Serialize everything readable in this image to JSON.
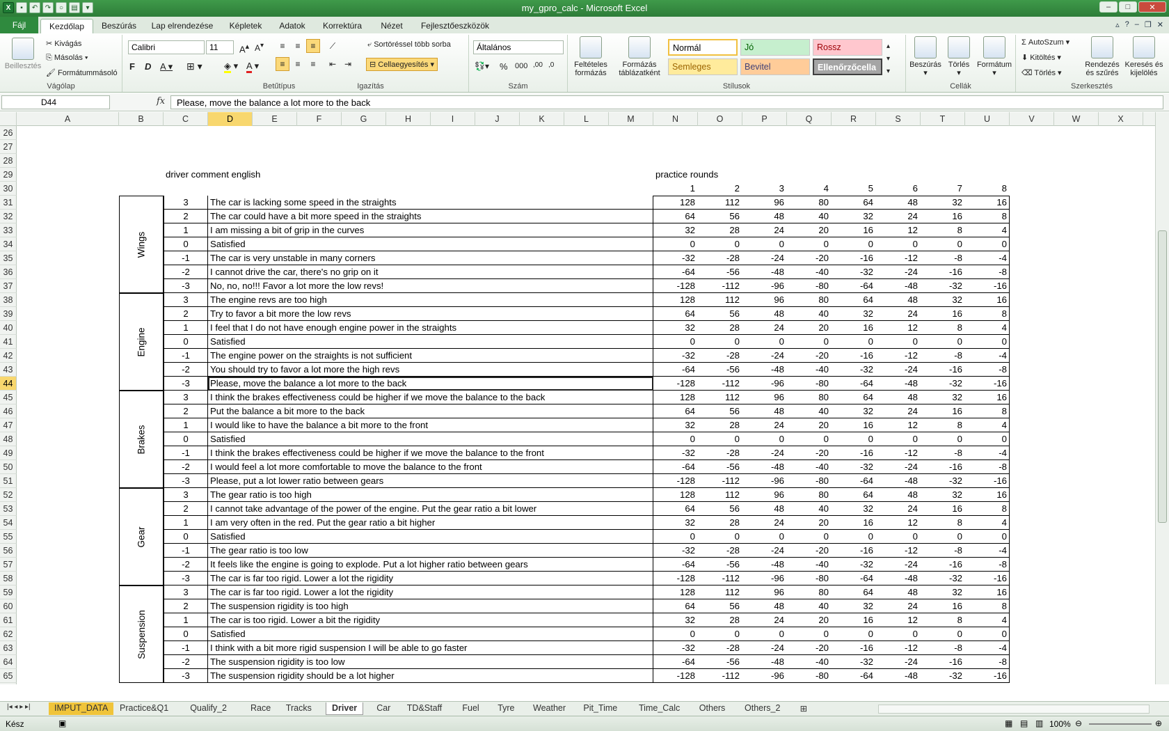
{
  "window": {
    "title": "my_gpro_calc - Microsoft Excel"
  },
  "tabs": [
    "Fájl",
    "Kezdőlap",
    "Beszúrás",
    "Lap elrendezése",
    "Képletek",
    "Adatok",
    "Korrektúra",
    "Nézet",
    "Fejlesztőeszközök"
  ],
  "ribbon": {
    "clipboard": {
      "label": "Vágólap",
      "paste": "Beillesztés",
      "cut": "Kivágás",
      "copy": "Másolás",
      "painter": "Formátummásoló"
    },
    "font": {
      "label": "Betűtípus",
      "name": "Calibri",
      "size": "11"
    },
    "alignment": {
      "label": "Igazítás",
      "wrap": "Sortöréssel több sorba",
      "merge": "Cellaegyesítés"
    },
    "number": {
      "label": "Szám",
      "format": "Általános"
    },
    "styles": {
      "label": "Stílusok",
      "cond": "Feltételes formázás",
      "astable": "Formázás táblázatként",
      "cells": [
        "Normál",
        "Jó",
        "Rossz",
        "Semleges",
        "Bevitel",
        "Ellenőrzőcella"
      ]
    },
    "cells": {
      "label": "Cellák",
      "insert": "Beszúrás",
      "delete": "Törlés",
      "format": "Formátum"
    },
    "editing": {
      "label": "Szerkesztés",
      "autosum": "AutoSzum",
      "fill": "Kitöltés",
      "clear": "Törlés",
      "sort": "Rendezés és szűrés",
      "find": "Keresés és kijelölés"
    }
  },
  "formula_bar": {
    "name_box": "D44",
    "fx": "fx",
    "content": "Please, move the balance a lot more to the back"
  },
  "columns": [
    "A",
    "B",
    "C",
    "D",
    "E",
    "F",
    "G",
    "H",
    "I",
    "J",
    "K",
    "L",
    "M",
    "N",
    "O",
    "P",
    "Q",
    "R",
    "S",
    "T",
    "U",
    "V",
    "W",
    "X"
  ],
  "sheet": {
    "header_left": "driver comment  english",
    "header_right": "practice rounds",
    "rounds": [
      "1",
      "2",
      "3",
      "4",
      "5",
      "6",
      "7",
      "8"
    ],
    "groups": [
      "Wings",
      "Engine",
      "Brakes",
      "Gear",
      "Suspension"
    ],
    "rows": [
      [
        "3",
        "The car is lacking some speed in the straights",
        "128",
        "112",
        "96",
        "80",
        "64",
        "48",
        "32",
        "16"
      ],
      [
        "2",
        "The car could have a bit more speed in the straights",
        "64",
        "56",
        "48",
        "40",
        "32",
        "24",
        "16",
        "8"
      ],
      [
        "1",
        "I am missing a bit of grip in the curves",
        "32",
        "28",
        "24",
        "20",
        "16",
        "12",
        "8",
        "4"
      ],
      [
        "0",
        "Satisfied",
        "0",
        "0",
        "0",
        "0",
        "0",
        "0",
        "0",
        "0"
      ],
      [
        "-1",
        "The car is very unstable in many corners",
        "-32",
        "-28",
        "-24",
        "-20",
        "-16",
        "-12",
        "-8",
        "-4"
      ],
      [
        "-2",
        "I cannot drive the car, there's no grip on it",
        "-64",
        "-56",
        "-48",
        "-40",
        "-32",
        "-24",
        "-16",
        "-8"
      ],
      [
        "-3",
        "No, no, no!!! Favor a lot more the low revs!",
        "-128",
        "-112",
        "-96",
        "-80",
        "-64",
        "-48",
        "-32",
        "-16"
      ],
      [
        "3",
        "The engine revs are too high",
        "128",
        "112",
        "96",
        "80",
        "64",
        "48",
        "32",
        "16"
      ],
      [
        "2",
        "Try to favor a bit more the low revs",
        "64",
        "56",
        "48",
        "40",
        "32",
        "24",
        "16",
        "8"
      ],
      [
        "1",
        "I feel that I do not have enough engine power in the straights",
        "32",
        "28",
        "24",
        "20",
        "16",
        "12",
        "8",
        "4"
      ],
      [
        "0",
        "Satisfied",
        "0",
        "0",
        "0",
        "0",
        "0",
        "0",
        "0",
        "0"
      ],
      [
        "-1",
        "The engine power on the straights is not sufficient",
        "-32",
        "-28",
        "-24",
        "-20",
        "-16",
        "-12",
        "-8",
        "-4"
      ],
      [
        "-2",
        "You should try to favor a lot more the high revs",
        "-64",
        "-56",
        "-48",
        "-40",
        "-32",
        "-24",
        "-16",
        "-8"
      ],
      [
        "-3",
        "Please, move the balance a lot more to the back",
        "-128",
        "-112",
        "-96",
        "-80",
        "-64",
        "-48",
        "-32",
        "-16"
      ],
      [
        "3",
        "I think the brakes effectiveness could be higher if we move the balance to the back",
        "128",
        "112",
        "96",
        "80",
        "64",
        "48",
        "32",
        "16"
      ],
      [
        "2",
        "Put the balance a bit more to the back",
        "64",
        "56",
        "48",
        "40",
        "32",
        "24",
        "16",
        "8"
      ],
      [
        "1",
        "I would like to have the balance a bit more to the front",
        "32",
        "28",
        "24",
        "20",
        "16",
        "12",
        "8",
        "4"
      ],
      [
        "0",
        "Satisfied",
        "0",
        "0",
        "0",
        "0",
        "0",
        "0",
        "0",
        "0"
      ],
      [
        "-1",
        "I think the brakes effectiveness could be higher if we move the balance to the front",
        "-32",
        "-28",
        "-24",
        "-20",
        "-16",
        "-12",
        "-8",
        "-4"
      ],
      [
        "-2",
        "I would feel a lot more comfortable to move the balance to the front",
        "-64",
        "-56",
        "-48",
        "-40",
        "-32",
        "-24",
        "-16",
        "-8"
      ],
      [
        "-3",
        "Please, put a lot lower ratio between gears",
        "-128",
        "-112",
        "-96",
        "-80",
        "-64",
        "-48",
        "-32",
        "-16"
      ],
      [
        "3",
        "The gear ratio is too high",
        "128",
        "112",
        "96",
        "80",
        "64",
        "48",
        "32",
        "16"
      ],
      [
        "2",
        "I cannot take advantage of the power of the engine. Put the gear ratio a bit lower",
        "64",
        "56",
        "48",
        "40",
        "32",
        "24",
        "16",
        "8"
      ],
      [
        "1",
        "I am very often in the red. Put the gear ratio a bit higher",
        "32",
        "28",
        "24",
        "20",
        "16",
        "12",
        "8",
        "4"
      ],
      [
        "0",
        "Satisfied",
        "0",
        "0",
        "0",
        "0",
        "0",
        "0",
        "0",
        "0"
      ],
      [
        "-1",
        "The gear ratio is too low",
        "-32",
        "-28",
        "-24",
        "-20",
        "-16",
        "-12",
        "-8",
        "-4"
      ],
      [
        "-2",
        "It feels like the engine is going to explode. Put a lot higher ratio between gears",
        "-64",
        "-56",
        "-48",
        "-40",
        "-32",
        "-24",
        "-16",
        "-8"
      ],
      [
        "-3",
        "The car is far too rigid. Lower a lot the rigidity",
        "-128",
        "-112",
        "-96",
        "-80",
        "-64",
        "-48",
        "-32",
        "-16"
      ],
      [
        "3",
        "The car is far too rigid. Lower a lot the rigidity",
        "128",
        "112",
        "96",
        "80",
        "64",
        "48",
        "32",
        "16"
      ],
      [
        "2",
        "The suspension rigidity is too high",
        "64",
        "56",
        "48",
        "40",
        "32",
        "24",
        "16",
        "8"
      ],
      [
        "1",
        "The car is too rigid. Lower a bit the rigidity",
        "32",
        "28",
        "24",
        "20",
        "16",
        "12",
        "8",
        "4"
      ],
      [
        "0",
        "Satisfied",
        "0",
        "0",
        "0",
        "0",
        "0",
        "0",
        "0",
        "0"
      ],
      [
        "-1",
        "I think with a bit more rigid suspension I will be able to go faster",
        "-32",
        "-28",
        "-24",
        "-20",
        "-16",
        "-12",
        "-8",
        "-4"
      ],
      [
        "-2",
        "The suspension rigidity is too low",
        "-64",
        "-56",
        "-48",
        "-40",
        "-32",
        "-24",
        "-16",
        "-8"
      ],
      [
        "-3",
        "The suspension rigidity should be a lot higher",
        "-128",
        "-112",
        "-96",
        "-80",
        "-64",
        "-48",
        "-32",
        "-16"
      ]
    ]
  },
  "sheet_tabs": [
    "IMPUT_DATA",
    "Practice&Q1",
    "Qualify_2",
    "Race",
    "Tracks",
    "Driver",
    "Car",
    "TD&Staff",
    "Fuel",
    "Tyre",
    "Weather",
    "Pit_Time",
    "Time_Calc",
    "Others",
    "Others_2"
  ],
  "active_sheet": "Driver",
  "status": {
    "ready": "Kész",
    "zoom": "100%"
  }
}
